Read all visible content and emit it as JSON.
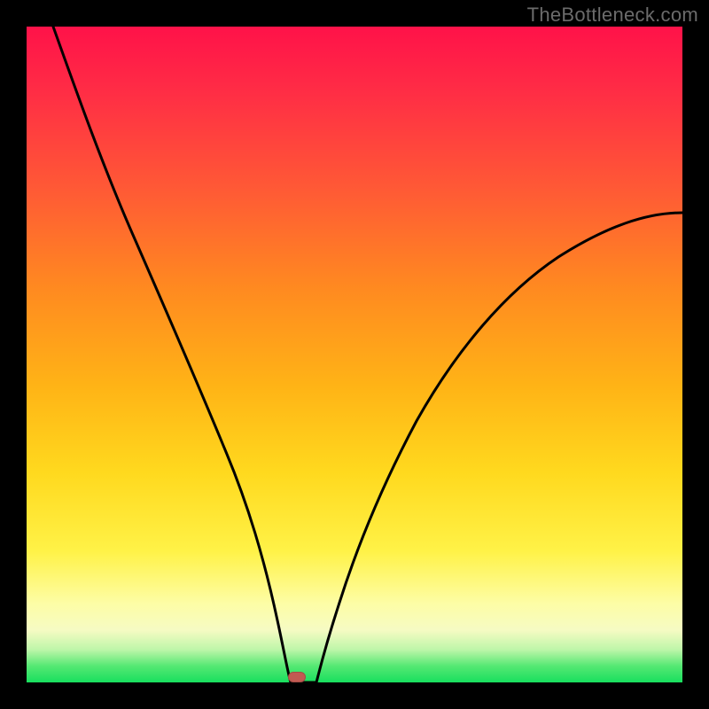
{
  "watermark": "TheBottleneck.com",
  "colors": {
    "background": "#000000",
    "gradient_top": "#ff1249",
    "gradient_mid": "#ffd91e",
    "gradient_bottom": "#18df5e",
    "curve": "#000000",
    "marker": "#c25a52"
  },
  "chart_data": {
    "type": "line",
    "title": "",
    "xlabel": "",
    "ylabel": "",
    "xlim": [
      0,
      100
    ],
    "ylim": [
      0,
      100
    ],
    "grid": false,
    "legend": false,
    "annotations": [
      {
        "name": "marker",
        "x": 41,
        "y": 0
      }
    ],
    "series": [
      {
        "name": "bottleneck-curve",
        "x": [
          4,
          8,
          12,
          16,
          20,
          24,
          28,
          32,
          35,
          38,
          40,
          41,
          43,
          45,
          48,
          52,
          58,
          66,
          76,
          88,
          100
        ],
        "y": [
          100,
          88,
          77,
          67,
          57,
          48,
          39,
          30,
          22,
          14,
          6,
          0,
          0,
          6,
          14,
          24,
          37,
          49,
          59,
          66,
          71
        ]
      }
    ]
  }
}
